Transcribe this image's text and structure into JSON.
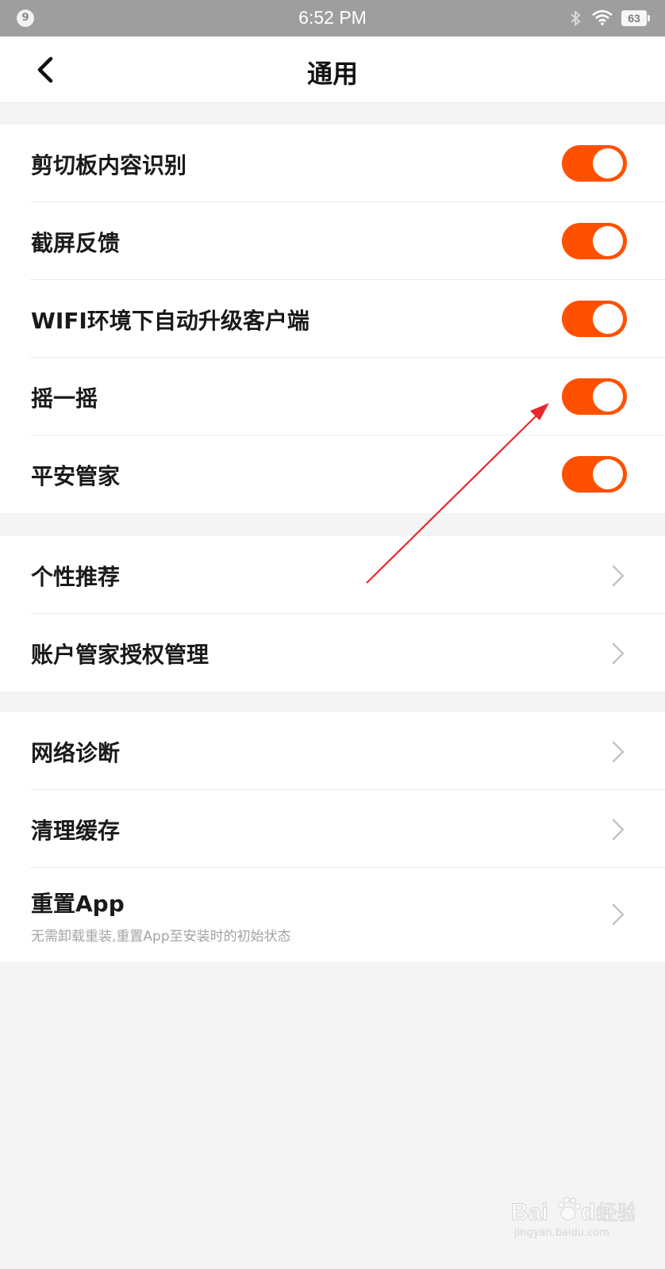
{
  "status_bar": {
    "notification_count": "9",
    "time": "6:52 PM",
    "battery": "63"
  },
  "nav": {
    "title": "通用"
  },
  "groups": {
    "toggles": [
      {
        "label": "剪切板内容识别",
        "on": true
      },
      {
        "label": "截屏反馈",
        "on": true
      },
      {
        "label": "WIFI环境下自动升级客户端",
        "on": true
      },
      {
        "label": "摇一摇",
        "on": true
      },
      {
        "label": "平安管家",
        "on": true
      }
    ],
    "privacy": [
      {
        "label": "个性推荐"
      },
      {
        "label": "账户管家授权管理"
      }
    ],
    "tools": [
      {
        "label": "网络诊断"
      },
      {
        "label": "清理缓存"
      },
      {
        "label": "重置App",
        "subtitle": "无需卸载重装,重置App至安装时的初始状态"
      }
    ]
  },
  "watermark": {
    "brand": "Bai",
    "brand2": "du",
    "product": "经验",
    "url": "jingyan.baidu.com"
  },
  "colors": {
    "accent": "#ff5000",
    "annotation_arrow": "#e8282b"
  }
}
